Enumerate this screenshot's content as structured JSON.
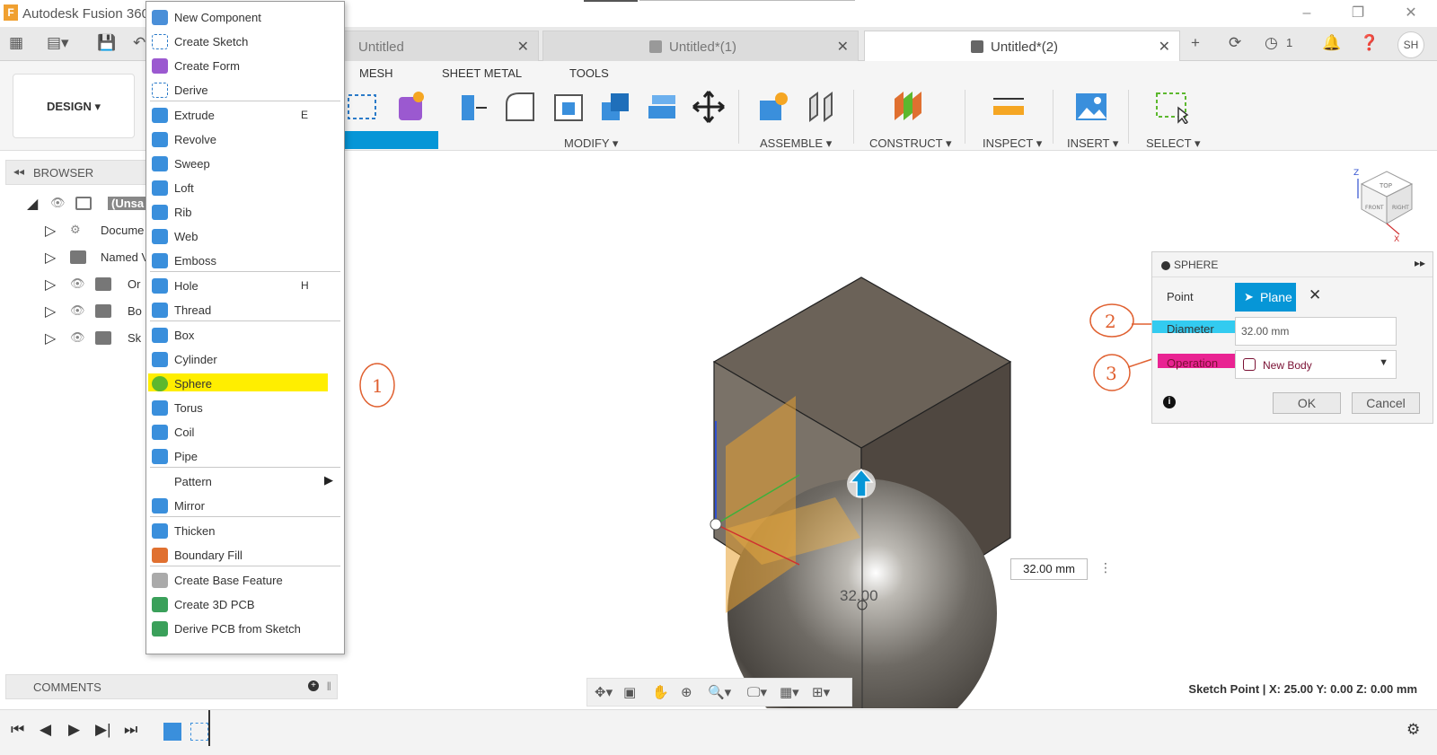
{
  "window": {
    "app_title": "Autodesk Fusion 360",
    "min": "–",
    "restore": "❐",
    "close": "✕"
  },
  "tabs": [
    {
      "label": "Untitled",
      "active": false
    },
    {
      "label": "Untitled*(1)",
      "active": false
    },
    {
      "label": "Untitled*(2)",
      "active": true
    }
  ],
  "topbar": {
    "job_count": "1",
    "user_initials": "SH"
  },
  "ribbon": {
    "workspace": "DESIGN ▾",
    "tabs": [
      "MESH",
      "SHEET METAL",
      "TOOLS"
    ],
    "groups": {
      "modify": "MODIFY ▾",
      "assemble": "ASSEMBLE ▾",
      "construct": "CONSTRUCT ▾",
      "inspect": "INSPECT ▾",
      "insert": "INSERT ▾",
      "select": "SELECT ▾"
    }
  },
  "browser": {
    "title": "BROWSER",
    "items": [
      {
        "label": "(Unsa"
      },
      {
        "label": "Docume"
      },
      {
        "label": "Named V"
      },
      {
        "label": "Or"
      },
      {
        "label": "Bo"
      },
      {
        "label": "Sk"
      }
    ]
  },
  "menu": {
    "items": [
      {
        "label": "New Component",
        "shortcut": "",
        "icon": "new-component-icon",
        "color": "#4a8fd8"
      },
      {
        "label": "Create Sketch",
        "shortcut": "",
        "icon": "create-sketch-icon",
        "color": "#ffffff"
      },
      {
        "label": "Create Form",
        "shortcut": "",
        "icon": "create-form-icon",
        "color": "#9b59d0"
      },
      {
        "label": "Derive",
        "shortcut": "",
        "icon": "derive-icon",
        "color": "#ffffff"
      },
      {
        "label": "Extrude",
        "shortcut": "E",
        "icon": "extrude-icon",
        "color": "#3a8fdc"
      },
      {
        "label": "Revolve",
        "shortcut": "",
        "icon": "revolve-icon",
        "color": "#3a8fdc"
      },
      {
        "label": "Sweep",
        "shortcut": "",
        "icon": "sweep-icon",
        "color": "#3a8fdc"
      },
      {
        "label": "Loft",
        "shortcut": "",
        "icon": "loft-icon",
        "color": "#3a8fdc"
      },
      {
        "label": "Rib",
        "shortcut": "",
        "icon": "rib-icon",
        "color": "#3a8fdc"
      },
      {
        "label": "Web",
        "shortcut": "",
        "icon": "web-icon",
        "color": "#3a8fdc"
      },
      {
        "label": "Emboss",
        "shortcut": "",
        "icon": "emboss-icon",
        "color": "#3a8fdc"
      },
      {
        "label": "Hole",
        "shortcut": "H",
        "icon": "hole-icon",
        "color": "#3a8fdc"
      },
      {
        "label": "Thread",
        "shortcut": "",
        "icon": "thread-icon",
        "color": "#3a8fdc"
      },
      {
        "label": "Box",
        "shortcut": "",
        "icon": "box-icon",
        "color": "#3a8fdc"
      },
      {
        "label": "Cylinder",
        "shortcut": "",
        "icon": "cylinder-icon",
        "color": "#3a8fdc"
      },
      {
        "label": "Sphere",
        "shortcut": "",
        "icon": "sphere-icon",
        "color": "#5cb82e"
      },
      {
        "label": "Torus",
        "shortcut": "",
        "icon": "torus-icon",
        "color": "#3a8fdc"
      },
      {
        "label": "Coil",
        "shortcut": "",
        "icon": "coil-icon",
        "color": "#3a8fdc"
      },
      {
        "label": "Pipe",
        "shortcut": "",
        "icon": "pipe-icon",
        "color": "#3a8fdc"
      },
      {
        "label": "Pattern",
        "shortcut": "",
        "icon": "",
        "color": ""
      },
      {
        "label": "Mirror",
        "shortcut": "",
        "icon": "mirror-icon",
        "color": "#3a8fdc"
      },
      {
        "label": "Thicken",
        "shortcut": "",
        "icon": "thicken-icon",
        "color": "#3a8fdc"
      },
      {
        "label": "Boundary Fill",
        "shortcut": "",
        "icon": "boundary-fill-icon",
        "color": "#e07030"
      },
      {
        "label": "Create Base Feature",
        "shortcut": "",
        "icon": "base-feature-icon",
        "color": "#aaaaaa"
      },
      {
        "label": "Create 3D PCB",
        "shortcut": "",
        "icon": "pcb-icon",
        "color": "#3aa05a"
      },
      {
        "label": "Derive PCB from Sketch",
        "shortcut": "",
        "icon": "derive-pcb-icon",
        "color": "#3aa05a"
      }
    ]
  },
  "comments": {
    "title": "COMMENTS"
  },
  "sphere_dialog": {
    "title": "SPHERE",
    "point_label": "Point",
    "point_value": "Plane",
    "diameter_label": "Diameter",
    "diameter_value": "32.00 mm",
    "operation_label": "Operation",
    "operation_value": "New Body",
    "ok": "OK",
    "cancel": "Cancel"
  },
  "viewport": {
    "dimension_box": "32.00 mm",
    "dimension_label": "32.00",
    "status": "Sketch Point | X: 25.00 Y: 0.00 Z: 0.00 mm",
    "annotation_1": "1",
    "annotation_2": "2",
    "annotation_3": "3",
    "viewcube_top": "TOP",
    "viewcube_front": "FRONT",
    "viewcube_right": "RIGHT",
    "axis_z": "Z",
    "axis_x": "X"
  }
}
